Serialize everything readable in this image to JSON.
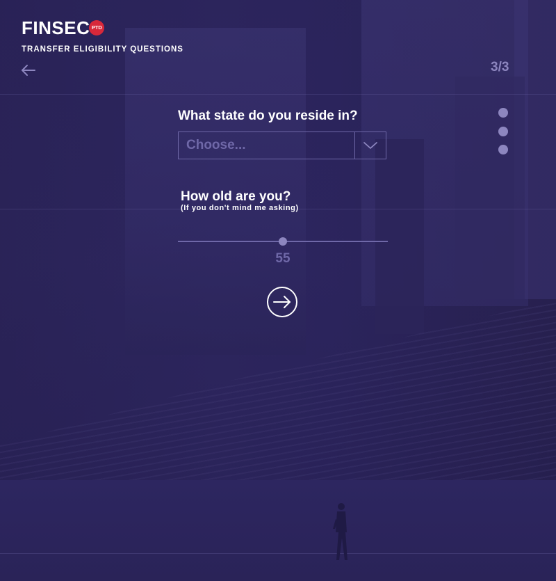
{
  "header": {
    "logo_text": "FINSEC",
    "logo_badge": "PTD",
    "subtitle": "TRANSFER ELIGIBILITY QUESTIONS",
    "back_icon": "arrow-left-icon",
    "step_counter": "3/3"
  },
  "progress_dots": {
    "count": 3
  },
  "form": {
    "state_question": "What state do you reside in?",
    "state_select": {
      "value": "Choose...",
      "icon": "chevron-down-icon"
    },
    "age_question": "How old are you?",
    "age_subtext": "(If you don't mind me asking)",
    "age_slider": {
      "value": 55,
      "position_fraction": 0.5
    },
    "age_value": "55",
    "next_icon": "arrow-right-circle-icon"
  },
  "colors": {
    "background": "#2a2356",
    "muted_accent": "#8d86bf",
    "field_border": "#6f68a8",
    "logo_badge": "#d8283a",
    "text": "#ffffff"
  }
}
